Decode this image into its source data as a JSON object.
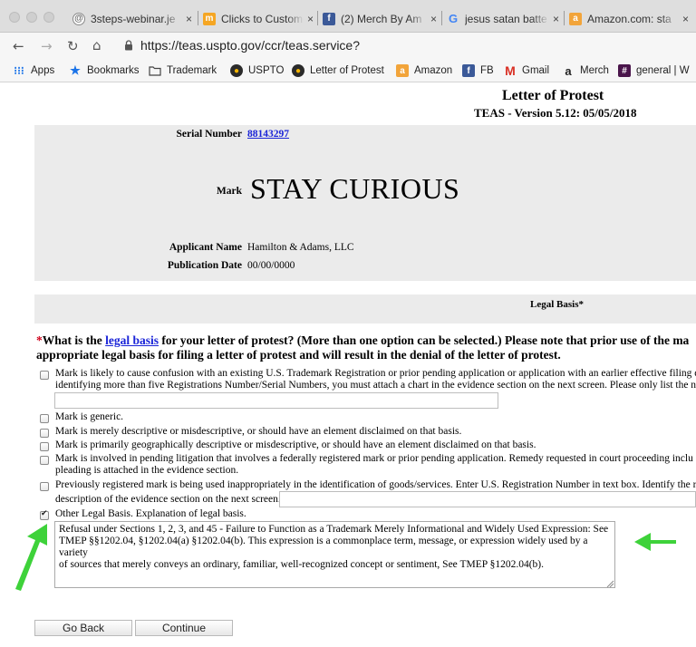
{
  "browser": {
    "tabs": [
      {
        "label": "3steps-webinar.je",
        "icon": "webinar-favicon"
      },
      {
        "label": "Clicks to Custome",
        "icon": "clickfunnels-favicon"
      },
      {
        "label": "(2) Merch By Am",
        "icon": "facebook-favicon"
      },
      {
        "label": "jesus satan batte",
        "icon": "google-favicon"
      },
      {
        "label": "Amazon.com: sta",
        "icon": "amazon-favicon"
      }
    ],
    "tab_close_glyph": "×",
    "url": "https://teas.uspto.gov/ccr/teas.service?",
    "bookmarks": [
      {
        "label": "Apps",
        "icon": "apps-icon"
      },
      {
        "label": "Bookmarks",
        "icon": "star-icon"
      },
      {
        "label": "Trademark",
        "icon": "folder-icon"
      },
      {
        "label": "USPTO",
        "icon": "uspto-icon"
      },
      {
        "label": "Letter of Protest",
        "icon": "uspto-icon"
      },
      {
        "label": "Amazon",
        "icon": "amazon-icon"
      },
      {
        "label": "FB",
        "icon": "facebook-icon"
      },
      {
        "label": "Gmail",
        "icon": "gmail-icon"
      },
      {
        "label": "Merch",
        "icon": "amazon-merch-icon"
      },
      {
        "label": "general | W",
        "icon": "slack-icon"
      }
    ]
  },
  "page": {
    "title": "Letter of Protest",
    "version": "TEAS - Version 5.12: 05/05/2018"
  },
  "application": {
    "serial_label": "Serial Number",
    "serial_value": "88143297",
    "mark_label": "Mark",
    "mark_value": "STAY CURIOUS",
    "applicant_label": "Applicant Name",
    "applicant_value": "Hamilton & Adams, LLC",
    "publication_label": "Publication Date",
    "publication_value": "00/00/0000"
  },
  "legal_basis": {
    "header": "Legal Basis*",
    "question": {
      "required_marker": "*",
      "part1": "What is the ",
      "link": "legal basis",
      "part2": " for your letter of protest? (More than one option can be selected.) Please note that prior use of the ma",
      "line2": "appropriate legal basis for filing a letter of protest and will result in the denial of the letter of protest."
    },
    "options": [
      {
        "lines": [
          "Mark is likely to cause confusion with an existing U.S. Trademark Registration or prior pending application or application with an earlier effective filing d",
          "identifying more than five Registrations Number/Serial Numbers, you must attach a chart in the evidence section on the next screen. Please only list the n"
        ],
        "checked": false
      },
      {
        "lines": [
          "Mark is generic."
        ],
        "checked": false
      },
      {
        "lines": [
          "Mark is merely descriptive or misdescriptive, or should have an element disclaimed on that basis."
        ],
        "checked": false
      },
      {
        "lines": [
          "Mark is primarily geographically descriptive or misdescriptive, or should have an element disclaimed on that basis."
        ],
        "checked": false
      },
      {
        "lines": [
          "Mark is involved in pending litigation that involves a federally registered mark or prior pending application. Remedy requested in court proceeding inclu",
          "pleading is attached in the evidence section."
        ],
        "checked": false
      },
      {
        "lines": [
          "Previously registered mark is being used inappropriately in the identification of goods/services. Enter U.S. Registration Number in text box. Identify the r",
          "description of the evidence section on the next screen."
        ],
        "checked": false
      },
      {
        "lines": [
          "Other Legal Basis. Explanation of legal basis."
        ],
        "checked": true
      }
    ],
    "explanation": "Refusal under Sections 1, 2, 3, and 45 - Failure to Function as a Trademark Merely Informational and Widely Used Expression: See\nTMEP §§1202.04, §1202.04(a) §1202.04(b). This expression is a commonplace term, message, or expression widely used by a variety\nof sources that merely conveys an ordinary, familiar, well-recognized concept or sentiment, See TMEP §1202.04(b)."
  },
  "buttons": {
    "back": "Go Back",
    "continue": "Continue"
  },
  "colors": {
    "annotation_arrow": "#3ed23a",
    "link": "#1a24d8",
    "required": "#d0021b",
    "panel_bg": "#ebebeb"
  }
}
